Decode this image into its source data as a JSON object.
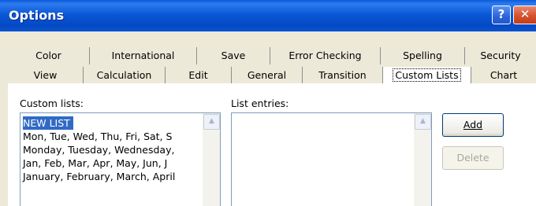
{
  "window": {
    "title": "Options"
  },
  "titlebar_buttons": {
    "help": "?",
    "close": "✕"
  },
  "tabs": {
    "back_row": [
      "Color",
      "International",
      "Save",
      "Error Checking",
      "Spelling",
      "Security"
    ],
    "front_row": [
      "View",
      "Calculation",
      "Edit",
      "General",
      "Transition",
      "Custom Lists",
      "Chart"
    ],
    "active": "Custom Lists"
  },
  "custom_lists": {
    "label": "Custom lists:",
    "items": [
      "NEW LIST",
      "Mon, Tue, Wed, Thu, Fri, Sat, S",
      "Monday, Tuesday, Wednesday, ",
      "Jan, Feb, Mar, Apr, May, Jun, J",
      "January, February, March, April"
    ],
    "selected_index": 0
  },
  "list_entries": {
    "label": "List entries:",
    "value": ""
  },
  "buttons": {
    "add": {
      "label": "Add",
      "enabled": true
    },
    "delete": {
      "label": "Delete",
      "enabled": false
    }
  }
}
